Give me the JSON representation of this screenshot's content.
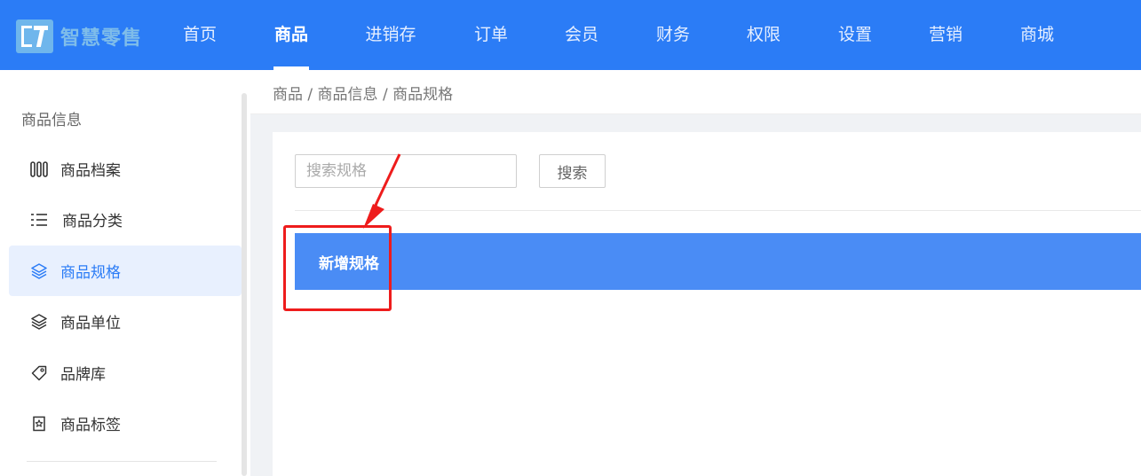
{
  "header": {
    "logo_text": "智慧零售",
    "nav": [
      "首页",
      "商品",
      "进销存",
      "订单",
      "会员",
      "财务",
      "权限",
      "设置",
      "营销",
      "商城"
    ],
    "active_index": 1
  },
  "sidebar": {
    "group_title": "商品信息",
    "items": [
      {
        "label": "商品档案",
        "icon": "archive-icon"
      },
      {
        "label": "商品分类",
        "icon": "list-icon"
      },
      {
        "label": "商品规格",
        "icon": "layers-icon"
      },
      {
        "label": "商品单位",
        "icon": "layers-icon"
      },
      {
        "label": "品牌库",
        "icon": "tag-icon"
      },
      {
        "label": "商品标签",
        "icon": "star-tag-icon"
      }
    ],
    "active_index": 2
  },
  "breadcrumb": "商品 / 商品信息 / 商品规格",
  "main": {
    "search_placeholder": "搜索规格",
    "search_button": "搜索",
    "add_button": "新增规格"
  },
  "colors": {
    "header": "#2b7cf6",
    "add_bar": "#4a8cf5",
    "annotation": "#ee1c1c"
  }
}
